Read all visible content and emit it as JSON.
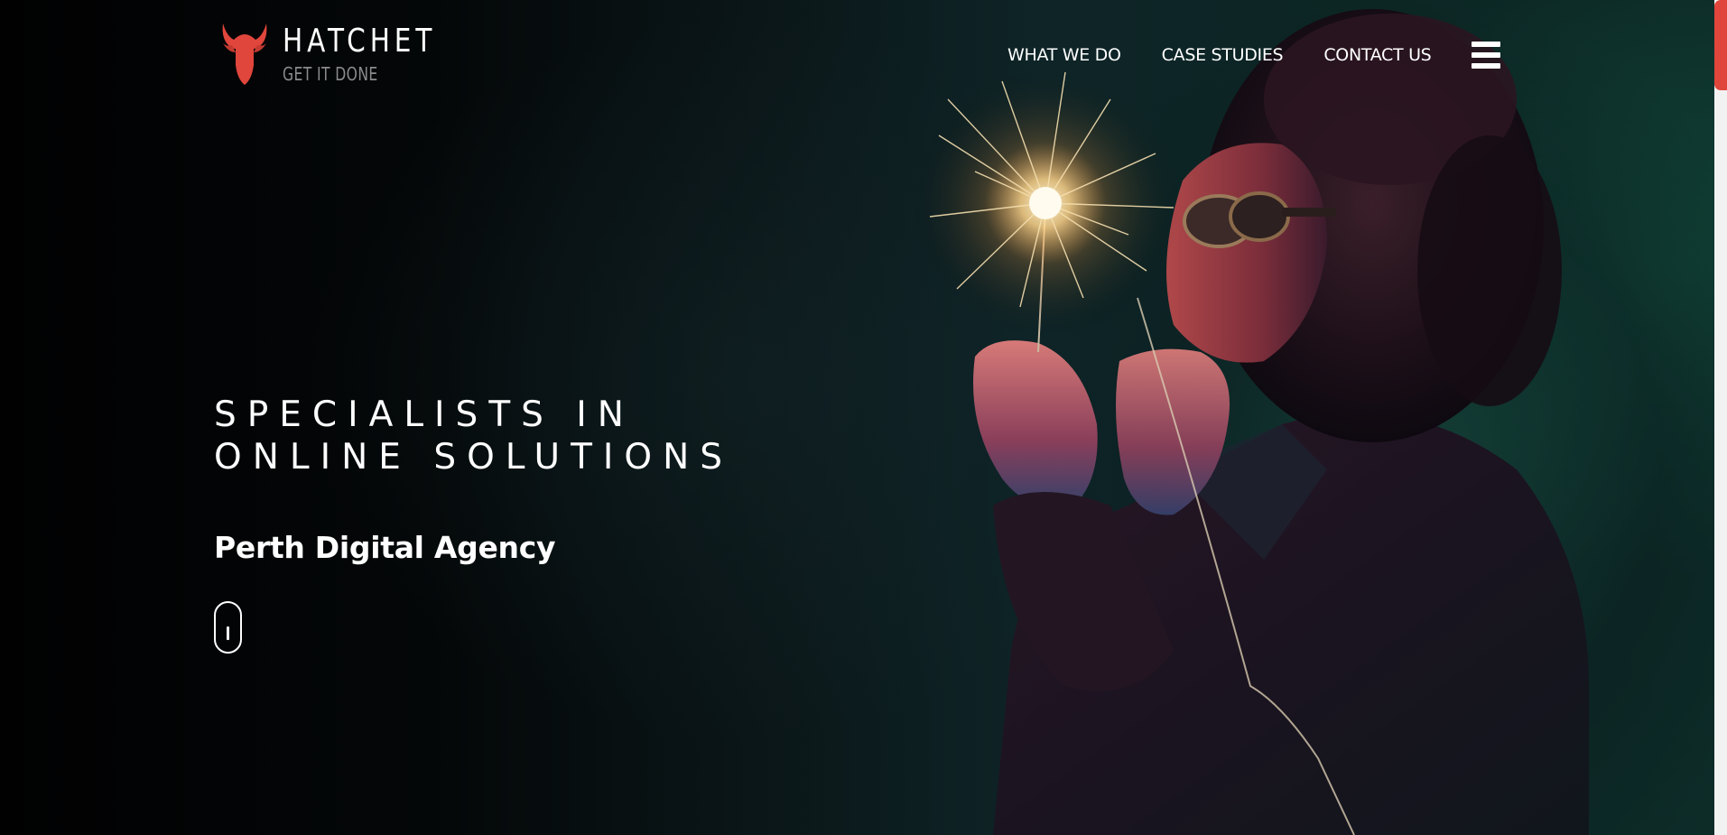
{
  "brand": {
    "name": "HATCHET",
    "tagline": "GET IT DONE",
    "logo_icon": "bull-head-icon",
    "accent_color": "#e0463c"
  },
  "nav": {
    "items": [
      {
        "label": "WHAT WE DO"
      },
      {
        "label": "CASE STUDIES"
      },
      {
        "label": "CONTACT US"
      }
    ],
    "menu_icon": "hamburger-menu-icon"
  },
  "hero": {
    "headline": "SPECIALISTS IN ONLINE SOLUTIONS",
    "subheadline": "Perth Digital Agency",
    "scroll_icon": "mouse-scroll-icon",
    "image_subject": "sparkler-portrait"
  },
  "colors": {
    "text": "#ffffff",
    "tagline": "#8b8b8b",
    "background_dark": "#020304",
    "background_teal": "#0d2c28"
  }
}
